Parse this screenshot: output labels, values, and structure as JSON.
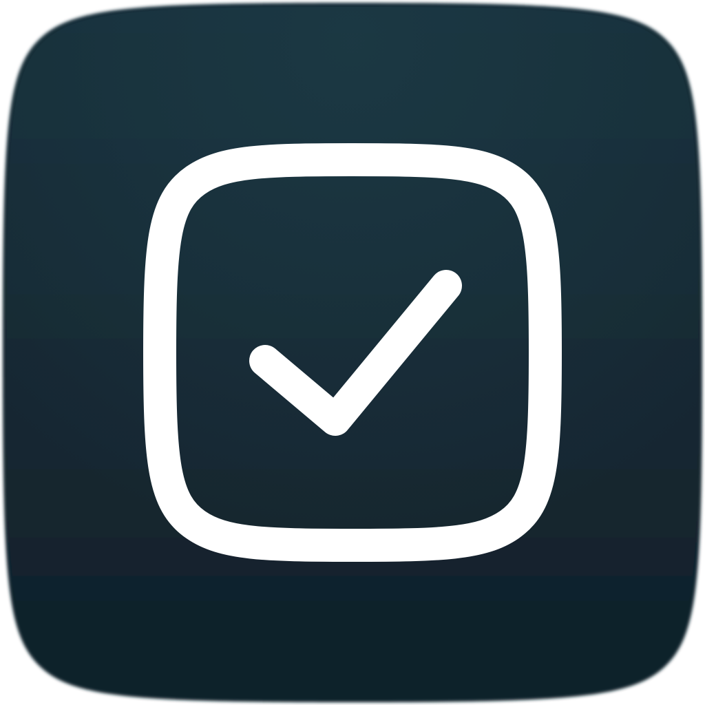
{
  "icon": {
    "name": "checkbox-checked-icon",
    "description_state": "checked",
    "colors": {
      "background_top": "#172f3a",
      "background_bottom": "#10212a",
      "highlight": "#1c3944",
      "glyph": "#ffffff"
    }
  }
}
